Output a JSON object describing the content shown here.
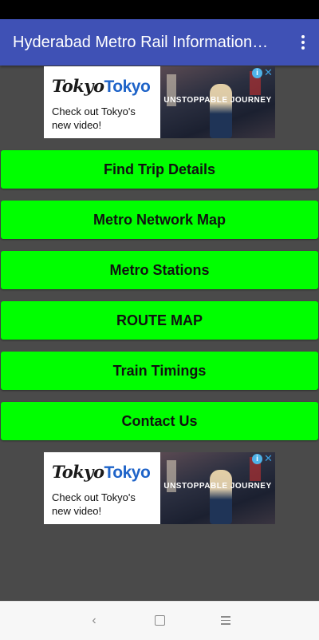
{
  "app_bar": {
    "title": "Hyderabad Metro Rail Information…"
  },
  "ad": {
    "brand_part1": "Tokyo",
    "brand_part2": "Tokyo",
    "subtitle": "Check out Tokyo's new video!",
    "tagline": "UNSTOPPABLE  JOURNEY",
    "info_icon": "i",
    "close_icon": "✕"
  },
  "menu": {
    "items": [
      {
        "label": "Find Trip Details"
      },
      {
        "label": "Metro Network Map"
      },
      {
        "label": "Metro Stations"
      },
      {
        "label": "ROUTE MAP"
      },
      {
        "label": "Train Timings"
      },
      {
        "label": "Contact Us"
      }
    ]
  },
  "nav": {
    "back": "‹"
  },
  "colors": {
    "app_bar": "#3f51b5",
    "button": "#00ff00",
    "background": "#4a4a4a"
  }
}
